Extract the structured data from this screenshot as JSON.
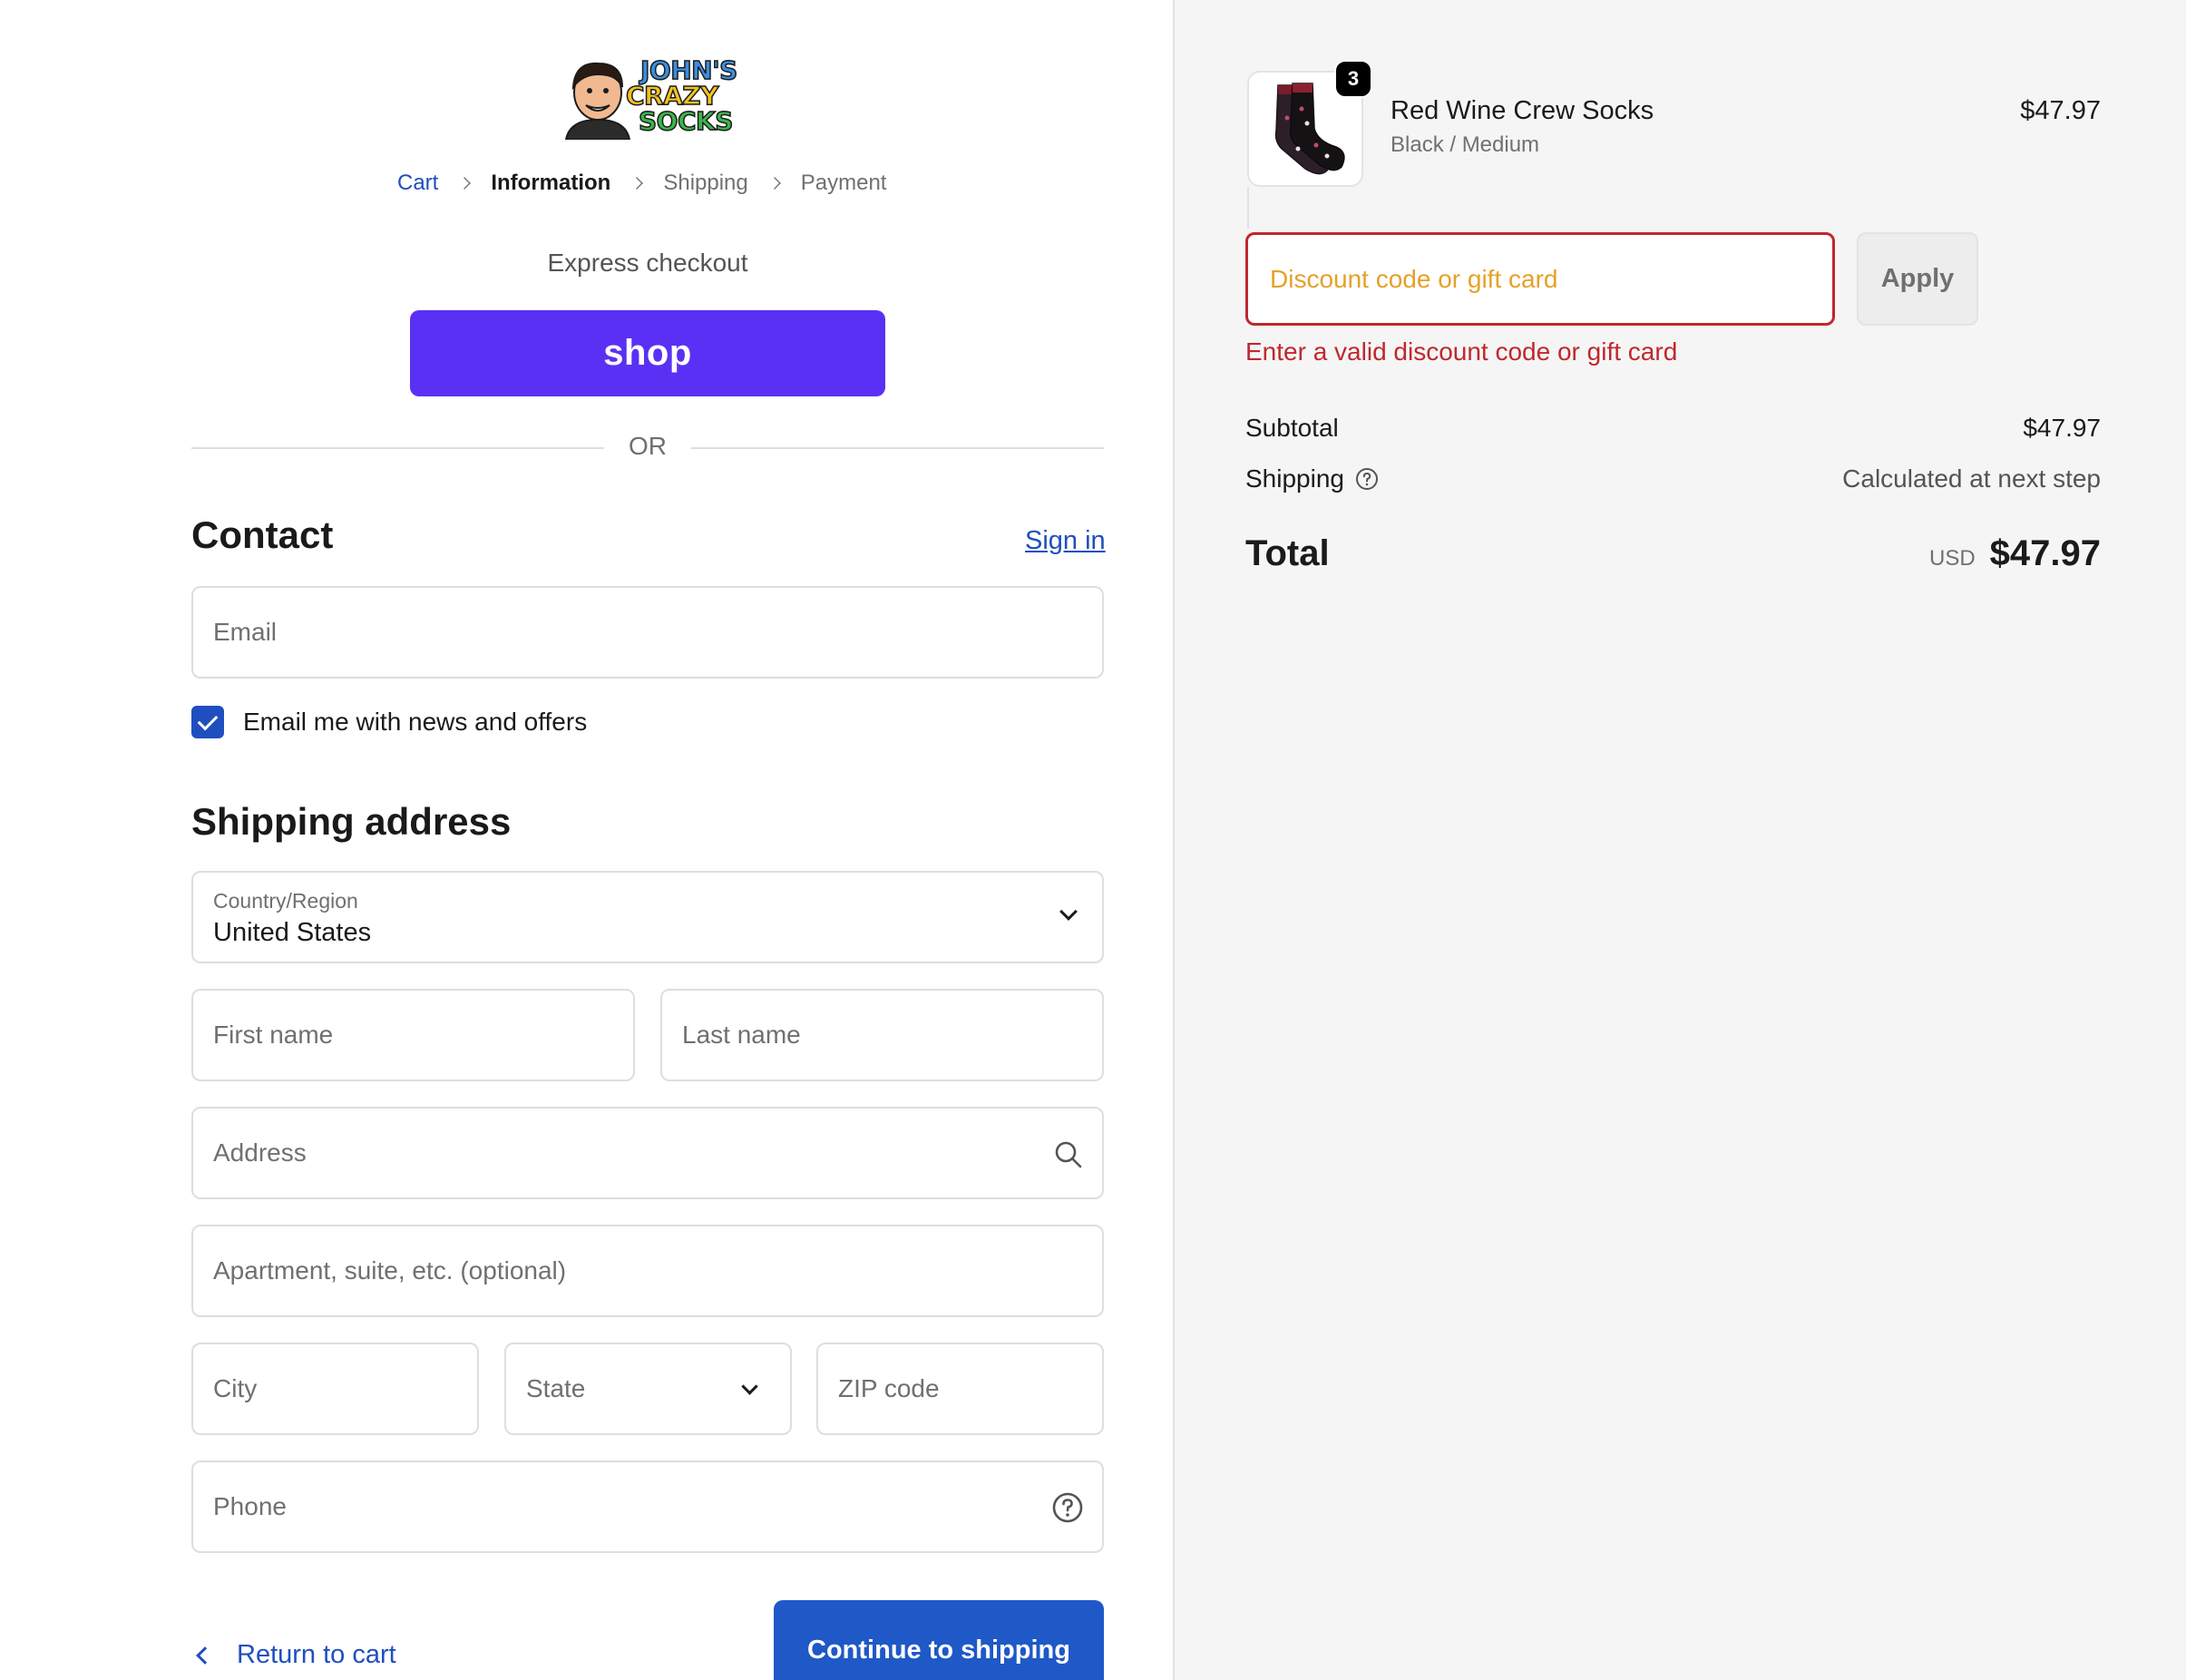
{
  "brand": {
    "logo_line1": "JOHN'S",
    "logo_line2": "CRAZY",
    "logo_line3": "SOCKS"
  },
  "breadcrumb": [
    {
      "label": "Cart",
      "state": "link"
    },
    {
      "label": "Information",
      "state": "current"
    },
    {
      "label": "Shipping",
      "state": "upcoming"
    },
    {
      "label": "Payment",
      "state": "upcoming"
    }
  ],
  "express": {
    "label": "Express checkout",
    "shop_button": "shop",
    "divider": "OR"
  },
  "contact": {
    "heading": "Contact",
    "sign_in": "Sign in",
    "email_placeholder": "Email",
    "newsletter_label": "Email me with news and offers",
    "newsletter_checked": true
  },
  "shipping_address": {
    "heading": "Shipping address",
    "country_label": "Country/Region",
    "country_value": "United States",
    "first_name_placeholder": "First name",
    "last_name_placeholder": "Last name",
    "address_placeholder": "Address",
    "apartment_placeholder": "Apartment, suite, etc. (optional)",
    "city_placeholder": "City",
    "state_placeholder": "State",
    "zip_placeholder": "ZIP code",
    "phone_placeholder": "Phone"
  },
  "footer_actions": {
    "return_link": "Return to cart",
    "continue_button": "Continue to shipping"
  },
  "order_summary": {
    "item": {
      "name": "Red Wine Crew Socks",
      "variant": "Black / Medium",
      "price": "$47.97",
      "quantity": "3"
    },
    "discount": {
      "placeholder": "Discount code or gift card",
      "apply_label": "Apply",
      "error": "Enter a valid discount code or gift card"
    },
    "subtotal_label": "Subtotal",
    "subtotal_value": "$47.97",
    "shipping_label": "Shipping",
    "shipping_value": "Calculated at next step",
    "total_label": "Total",
    "currency": "USD",
    "total_value": "$47.97"
  },
  "colors": {
    "accent": "#1f58c7",
    "shop_purple": "#5a31f4",
    "error": "#c0272d",
    "summary_bg": "#f5f5f5"
  },
  "icons": [
    "chevron-right-icon",
    "checkbox-check-icon",
    "chevron-down-icon",
    "search-icon",
    "help-circle-icon",
    "chevron-left-icon"
  ]
}
